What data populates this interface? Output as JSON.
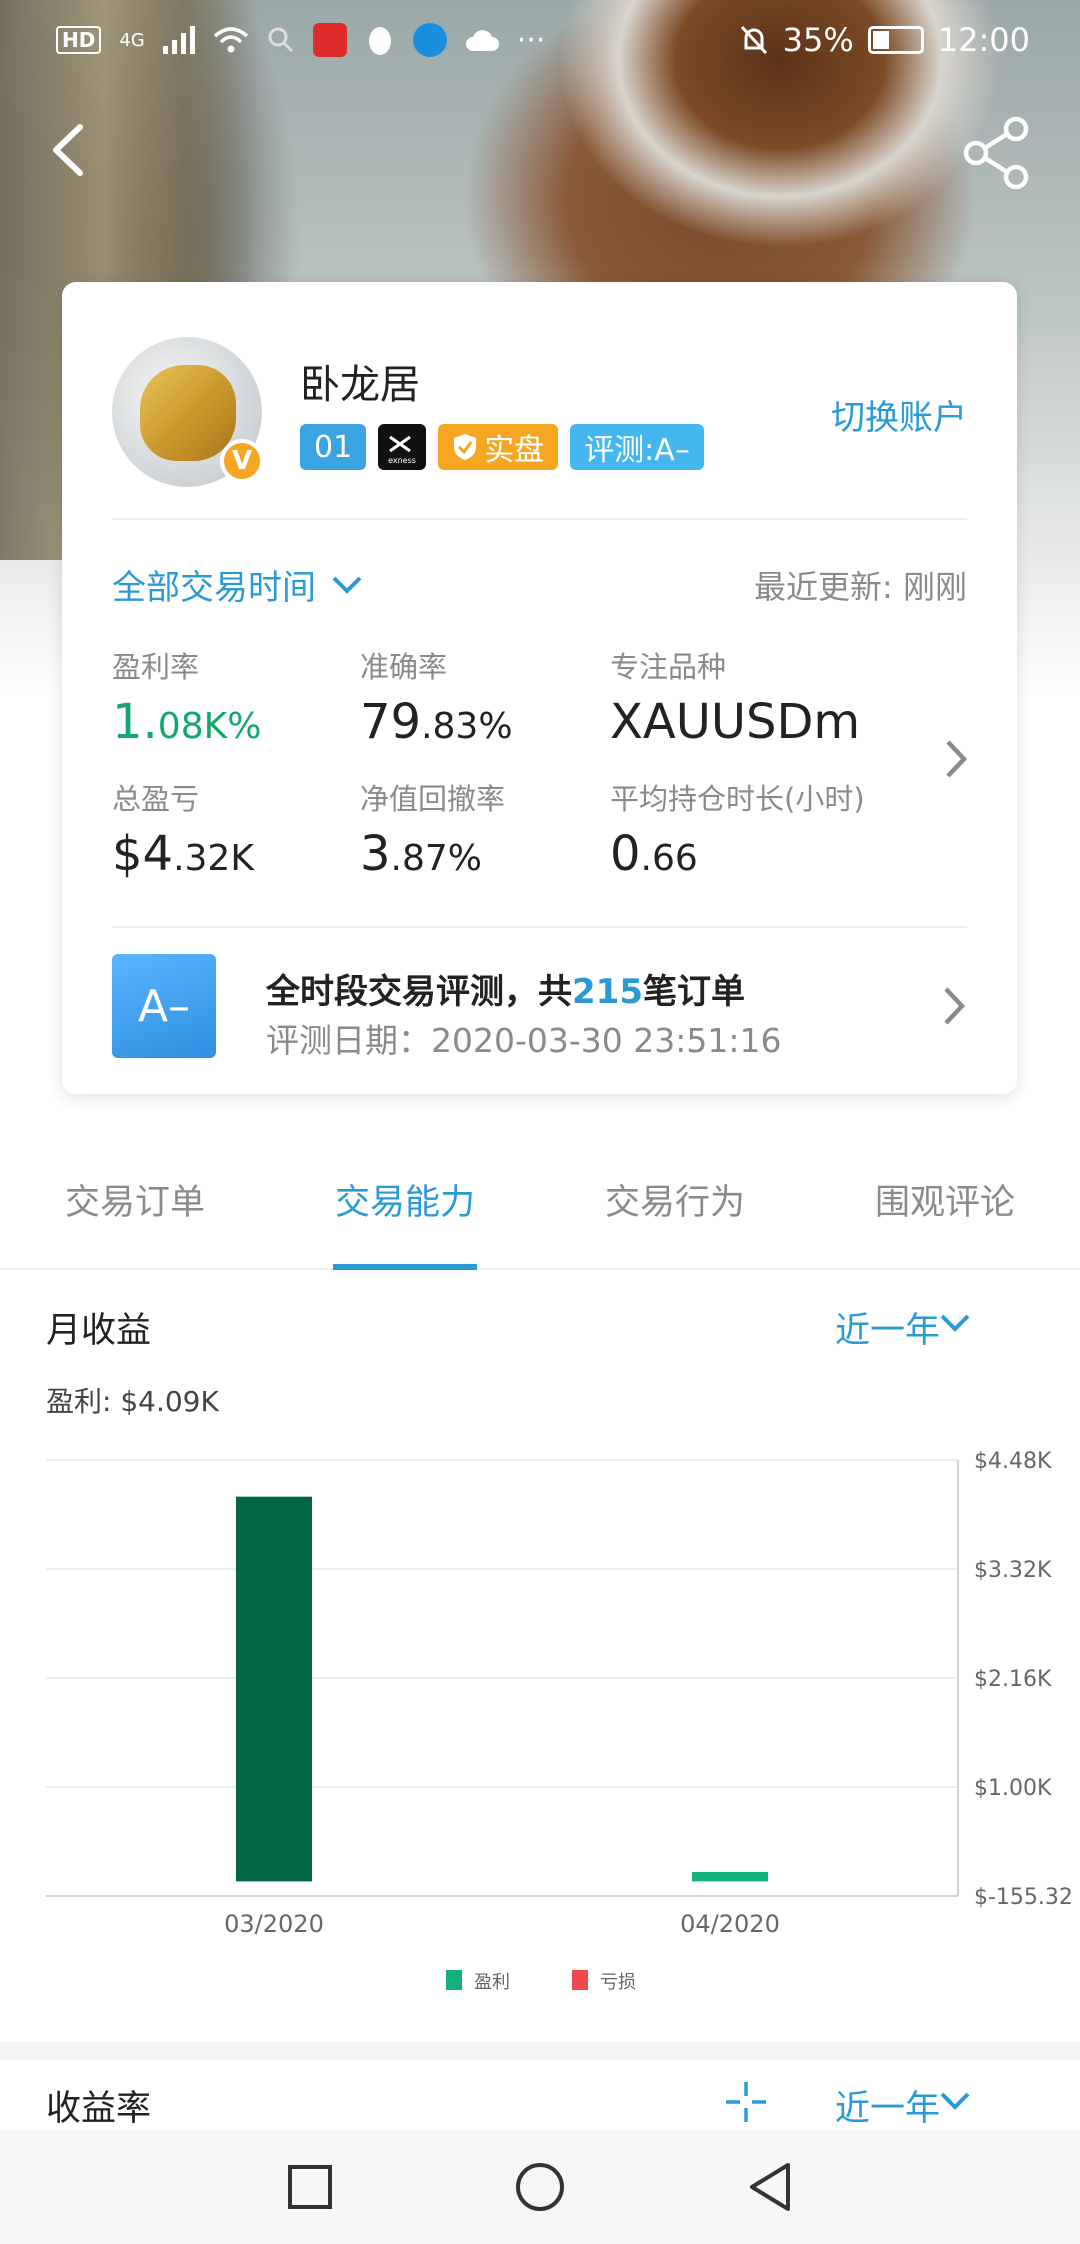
{
  "status_bar": {
    "left_labels": [
      "HD",
      "4G"
    ],
    "battery": "35%",
    "time": "12:00"
  },
  "profile": {
    "name": "卧龙居",
    "badges": [
      "01",
      "exness",
      "实盘",
      "评测:A–"
    ],
    "switch_account": "切换账户"
  },
  "filter": {
    "time_range": "全部交易时间",
    "last_update": "最近更新: 刚刚"
  },
  "stats": [
    {
      "label": "盈利率",
      "main": "1.",
      "small": "08K%",
      "green": true
    },
    {
      "label": "准确率",
      "main": "79",
      "small": ".83%"
    },
    {
      "label": "专注品种",
      "main": "XAUUSDm",
      "small": ""
    },
    {
      "label": "总盈亏",
      "main": "$4",
      "small": ".32K"
    },
    {
      "label": "净值回撤率",
      "main": "3",
      "small": ".87%"
    },
    {
      "label": "平均持仓时长(小时)",
      "main": "0",
      "small": ".66"
    }
  ],
  "rating": {
    "grade": "A–",
    "title_pre": "全时段交易评测，共",
    "title_num": "215",
    "title_post": "笔订单",
    "date": "评测日期：2020-03-30 23:51:16"
  },
  "tabs": [
    {
      "label": "交易订单",
      "active": false
    },
    {
      "label": "交易能力",
      "active": true
    },
    {
      "label": "交易行为",
      "active": false
    },
    {
      "label": "围观评论",
      "active": false
    }
  ],
  "monthly": {
    "title": "月收益",
    "period": "近一年",
    "profit_label": "盈利: $4.09K"
  },
  "chart_data": {
    "type": "bar",
    "categories": [
      "03/2020",
      "04/2020"
    ],
    "series": [
      {
        "name": "盈利",
        "values": [
          4090,
          100
        ],
        "colors": [
          "#006644",
          "#11b07d"
        ]
      },
      {
        "name": "亏损",
        "values": [
          0,
          0
        ],
        "colors": [
          "#f0494b"
        ]
      }
    ],
    "y_ticks": [
      "$4.48K",
      "$3.32K",
      "$2.16K",
      "$1.00K",
      "$-155.32"
    ],
    "ylim": [
      -155.32,
      4480
    ],
    "legend_placement": "bottom-center",
    "grid": true
  },
  "yield": {
    "title": "收益率",
    "period": "近一年"
  },
  "colors": {
    "accent": "#2a9ad6",
    "profit_green": "#11a86b",
    "loss_red": "#f0494b"
  }
}
